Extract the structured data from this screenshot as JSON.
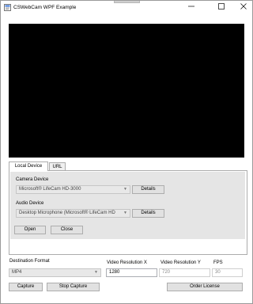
{
  "window": {
    "title": "CSWebCam WPF Example",
    "minimize_glyph": "—",
    "maximize_glyph": "□",
    "close_glyph": "✕"
  },
  "tabs": [
    {
      "label": "Local Device",
      "selected": true
    },
    {
      "label": "URL",
      "selected": false
    }
  ],
  "local_device": {
    "camera_label": "Camera Device",
    "camera_value": "Microsoft® LifeCam HD-3000",
    "camera_details_label": "Details",
    "audio_label": "Audio Device",
    "audio_value": "Desktop Microphone (Microsoft® LifeCam HD",
    "audio_details_label": "Details",
    "open_label": "Open",
    "close_label": "Close"
  },
  "output": {
    "destination_format_label": "Destination Format",
    "destination_format_value": "MP4",
    "video_res_x_label": "Video Resolution X",
    "video_res_x_value": "1280",
    "video_res_y_label": "Video Resolution Y",
    "video_res_y_value": "720",
    "fps_label": "FPS",
    "fps_value": "30"
  },
  "actions": {
    "capture_label": "Capture",
    "stop_capture_label": "Stop Capture",
    "order_license_label": "Order License"
  },
  "colors": {
    "video_background": "#000000",
    "group_background": "#e5e5e5",
    "button_background": "#e1e1e1"
  }
}
